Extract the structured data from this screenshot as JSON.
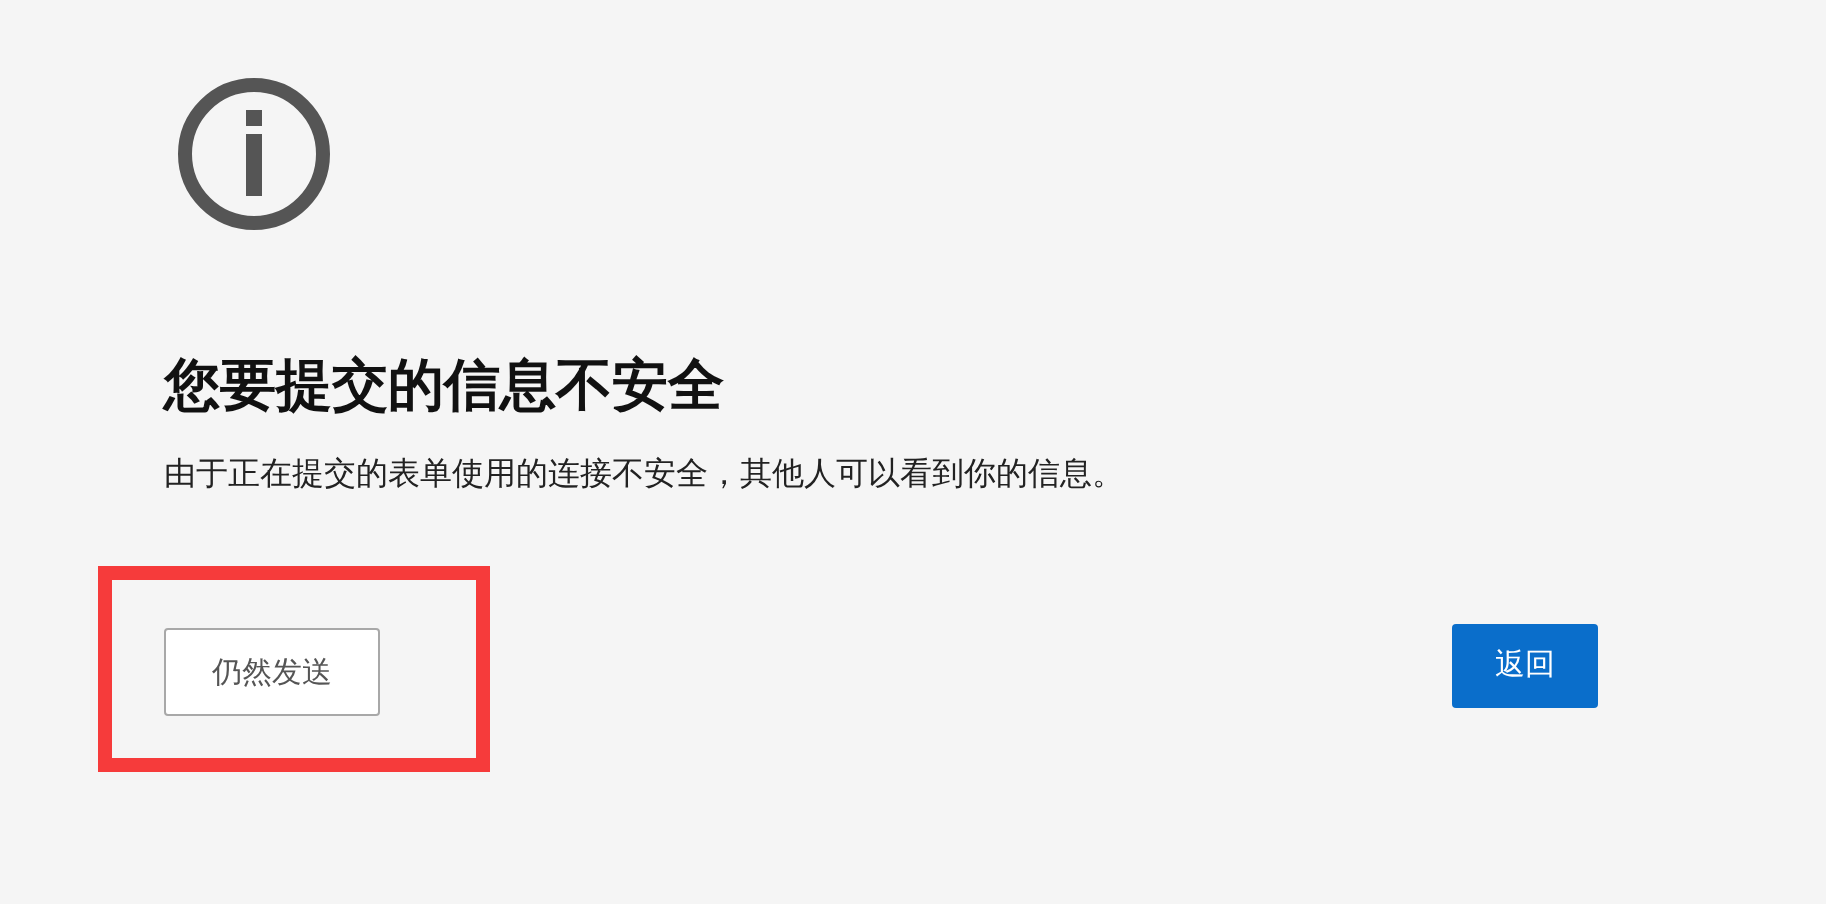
{
  "title": "您要提交的信息不安全",
  "message": "由于正在提交的表单使用的连接不安全，其他人可以看到你的信息。",
  "send_anyway_button": {
    "label": "仍然发送",
    "highlighted": true
  },
  "back_button": {
    "label": "返回"
  }
}
